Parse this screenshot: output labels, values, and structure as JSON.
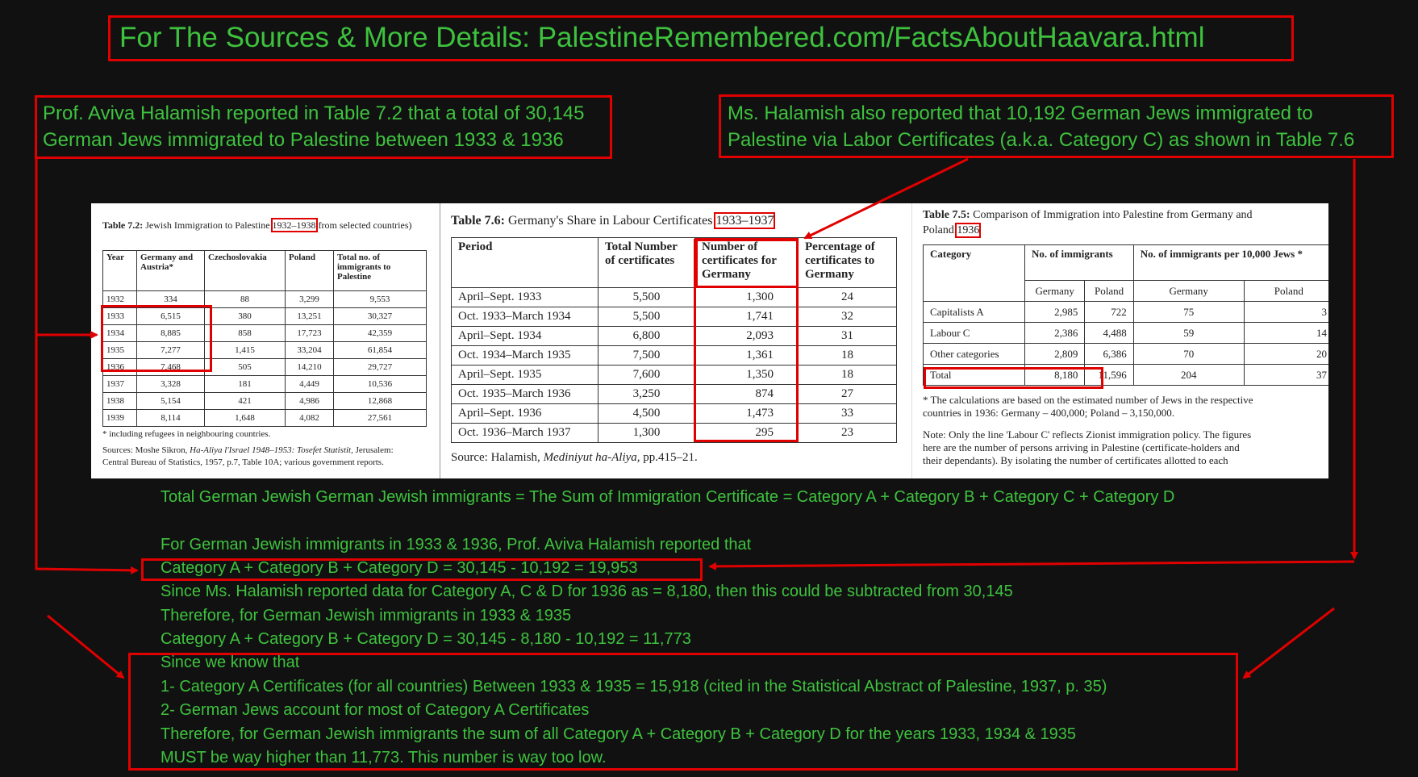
{
  "header": {
    "text": "For The Sources & More Details: PalestineRemembered.com/FactsAboutHaavara.html"
  },
  "notes": {
    "left": [
      "Prof. Aviva Halamish reported in Table 7.2 that a total of 30,145",
      "German Jews immigrated to Palestine between 1933 & 1936"
    ],
    "right": [
      "Ms. Halamish also reported that 10,192 German Jews immigrated to",
      "Palestine via Labor Certificates (a.k.a. Category C) as shown in Table 7.6"
    ]
  },
  "table72": {
    "caption_bold": "Table 7.2:",
    "caption_a": " Jewish Immigration to Palestine ",
    "caption_years": "1932–1938",
    "caption_b": " from selected countries)",
    "headers": [
      "Year",
      "Germany and Austria*",
      "Czechoslovakia",
      "Poland",
      "Total no. of immigrants to Palestine"
    ],
    "rows": [
      [
        "1932",
        "334",
        "88",
        "3,299",
        "9,553"
      ],
      [
        "1933",
        "6,515",
        "380",
        "13,251",
        "30,327"
      ],
      [
        "1934",
        "8,885",
        "858",
        "17,723",
        "42,359"
      ],
      [
        "1935",
        "7,277",
        "1,415",
        "33,204",
        "61,854"
      ],
      [
        "1936",
        "7,468",
        "505",
        "14,210",
        "29,727"
      ],
      [
        "1937",
        "3,328",
        "181",
        "4,449",
        "10,536"
      ],
      [
        "1938",
        "5,154",
        "421",
        "4,986",
        "12,868"
      ],
      [
        "1939",
        "8,114",
        "1,648",
        "4,082",
        "27,561"
      ]
    ],
    "footnote": "* including refugees in neighbouring countries.",
    "sources_a": "Sources: Moshe Sikron, ",
    "sources_italic": "Ha-Aliya l'Israel 1948–1953: Tosefet Statistit,",
    "sources_b": " Jerusalem:",
    "sources_line2": "Central Bureau of Statistics, 1957, p.7, Table 10A; various government reports."
  },
  "table76": {
    "caption_bold": "Table 7.6:",
    "caption_a": " Germany's Share in Labour Certificates ",
    "caption_years": "1933–1937",
    "headers": [
      "Period",
      "Total Number of certificates",
      "Number of certificates for Germany",
      "Percentage of certificates to Germany"
    ],
    "rows": [
      [
        "April–Sept. 1933",
        "5,500",
        "1,300",
        "24"
      ],
      [
        "Oct. 1933–March 1934",
        "5,500",
        "1,741",
        "32"
      ],
      [
        "April–Sept. 1934",
        "6,800",
        "2,093",
        "31"
      ],
      [
        "Oct. 1934–March 1935",
        "7,500",
        "1,361",
        "18"
      ],
      [
        "April–Sept. 1935",
        "7,600",
        "1,350",
        "18"
      ],
      [
        "Oct. 1935–March 1936",
        "3,250",
        "874",
        "27"
      ],
      [
        "April–Sept. 1936",
        "4,500",
        "1,473",
        "33"
      ],
      [
        "Oct. 1936–March 1937",
        "1,300",
        "295",
        "23"
      ]
    ],
    "source_a": "Source: Halamish, ",
    "source_italic": "Mediniyut ha-Aliya,",
    "source_b": " pp.415–21."
  },
  "table75": {
    "caption_bold": "Table 7.5:",
    "caption_a": " Comparison of Immigration into Palestine from Germany and",
    "caption_b": "Poland ",
    "caption_year": "1936",
    "h_category": "Category",
    "h_immigrants": "No. of immigrants",
    "h_per": "No. of immigrants per 10,000 Jews *",
    "sub": [
      "Germany",
      "Poland",
      "Germany",
      "Poland"
    ],
    "rows": [
      [
        "Capitalists A",
        "2,985",
        "722",
        "75",
        "3"
      ],
      [
        "Labour C",
        "2,386",
        "4,488",
        "59",
        "14"
      ],
      [
        "Other categories",
        "2,809",
        "6,386",
        "70",
        "20"
      ],
      [
        "Total",
        "8,180",
        "11,596",
        "204",
        "37"
      ]
    ],
    "footnote": [
      "* The calculations are based on the estimated number of Jews in the respective",
      "countries in 1936: Germany – 400,000; Poland – 3,150,000."
    ],
    "note": [
      "Note: Only the line 'Labour C' reflects Zionist immigration policy. The figures",
      "here are the number of persons arriving in Palestine (certificate-holders and",
      "their dependants). By isolating the number of certificates allotted to each"
    ]
  },
  "body": {
    "line1": "Total German Jewish German Jewish immigrants = The Sum of Immigration Certificate = Category A + Category B + Category C + Category D",
    "line2": "For German Jewish immigrants in 1933 & 1936, Prof. Aviva Halamish reported that",
    "line3": "Category A + Category B + Category D = 30,145 - 10,192 = 19,953",
    "line4": "Since Ms. Halamish reported data for Category A, C & D for 1936 as = 8,180, then this could be subtracted from 30,145",
    "line5": "Therefore, for German Jewish immigrants in 1933 & 1935",
    "line6": "Category A + Category B + Category D = 30,145 - 8,180 - 10,192 = 11,773",
    "line7": "Since we know that",
    "line8": "1- Category A Certificates (for all countries) Between 1933 & 1935 = 15,918 (cited in the Statistical Abstract of Palestine, 1937, p. 35)",
    "line9": "2- German Jews account for most of Category A Certificates",
    "line10": "Therefore, for German Jewish immigrants the sum of all Category A + Category B + Category D for the years 1933, 1934 & 1935",
    "line11": "MUST be way higher than 11,773. This number is way too low."
  },
  "colors": {
    "background": "#111111",
    "text": "#3ec23e",
    "highlight": "#e00000"
  }
}
